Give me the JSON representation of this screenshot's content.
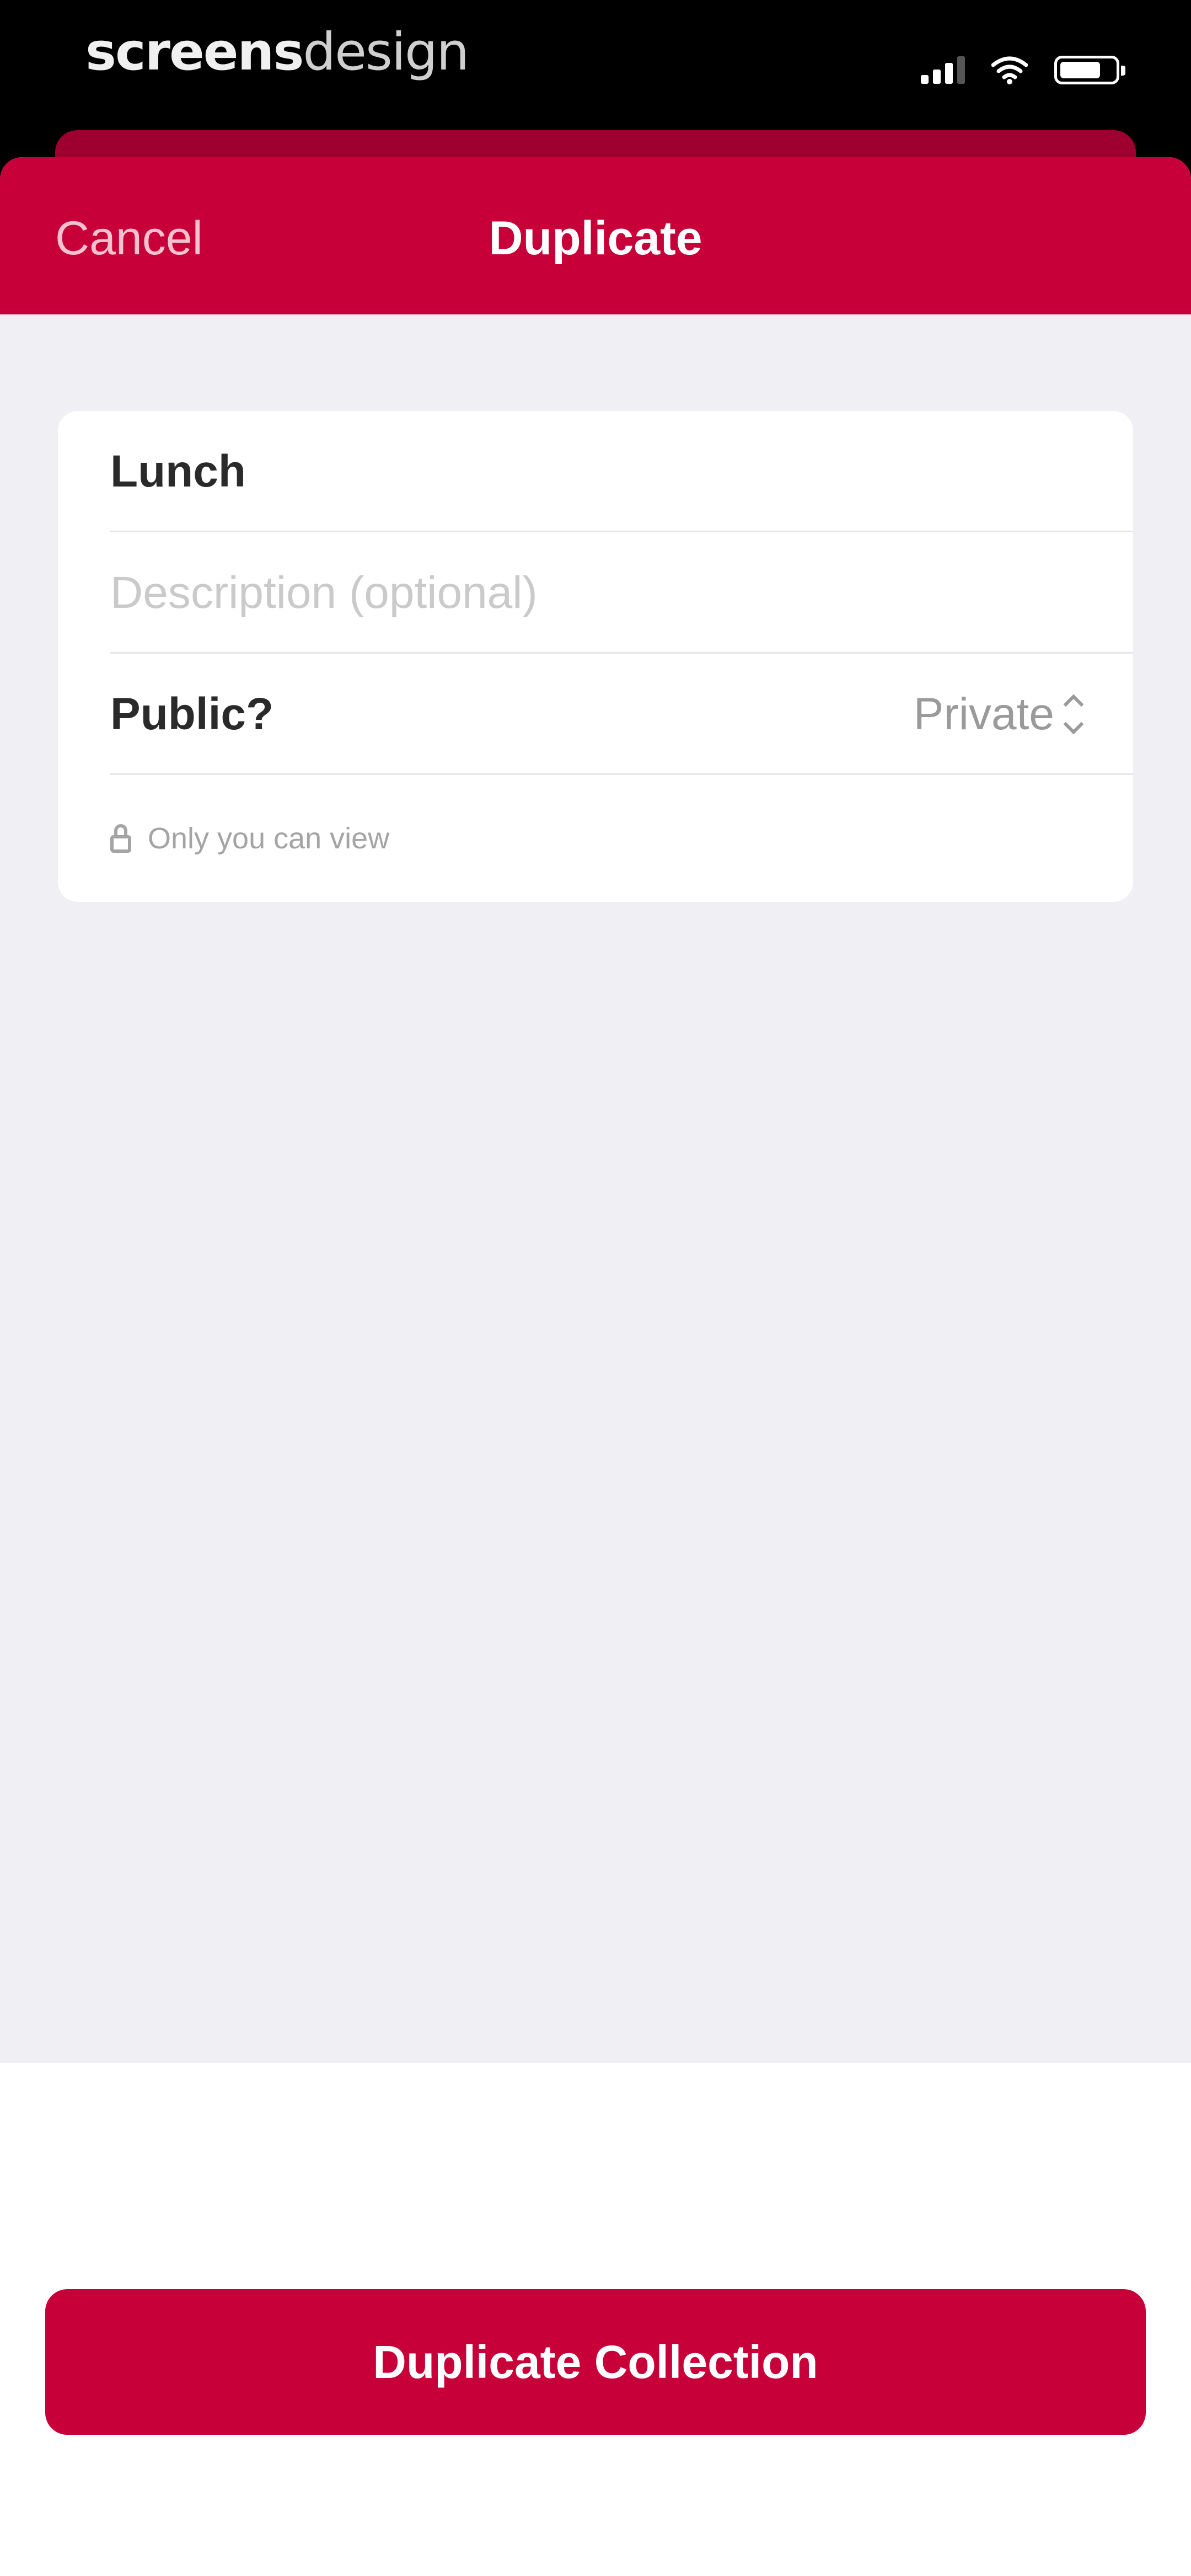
{
  "watermark": {
    "bold": "screens",
    "light": "design"
  },
  "nav": {
    "cancel_label": "Cancel",
    "title": "Duplicate"
  },
  "form": {
    "name_value": "Lunch",
    "description_value": "",
    "description_placeholder": "Description (optional)",
    "public_label": "Public?",
    "privacy_value": "Private",
    "privacy_hint": "Only you can view"
  },
  "footer": {
    "primary_label": "Duplicate Collection"
  },
  "colors": {
    "accent": "#c8003a",
    "background": "#efeff4",
    "card": "#ffffff",
    "secondary_text": "#9a9a9a"
  },
  "icons": [
    "signal-icon",
    "wifi-icon",
    "battery-icon",
    "chevron-updown-icon",
    "lock-icon"
  ]
}
